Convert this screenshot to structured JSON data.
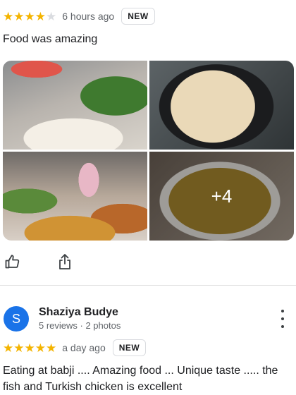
{
  "review1": {
    "rating": 4,
    "stars": [
      "★",
      "★",
      "★",
      "★",
      "★"
    ],
    "time": "6 hours ago",
    "badge": "NEW",
    "text": "Food was amazing",
    "more_photos": "+4"
  },
  "actions": {
    "like_icon": "thumbs-up-icon",
    "share_icon": "share-icon"
  },
  "review2": {
    "avatar_letter": "S",
    "name": "Shaziya Budye",
    "stats": "5 reviews · 2 photos",
    "rating": 5,
    "stars": [
      "★",
      "★",
      "★",
      "★",
      "★"
    ],
    "time": "a day ago",
    "badge": "NEW",
    "text": "Eating at babji .... Amazing food ... Unique taste ..... the fish and Turkish chicken is excellent"
  },
  "colors": {
    "star": "#f4b400",
    "star_empty": "#dadce0",
    "avatar": "#1a73e8"
  }
}
